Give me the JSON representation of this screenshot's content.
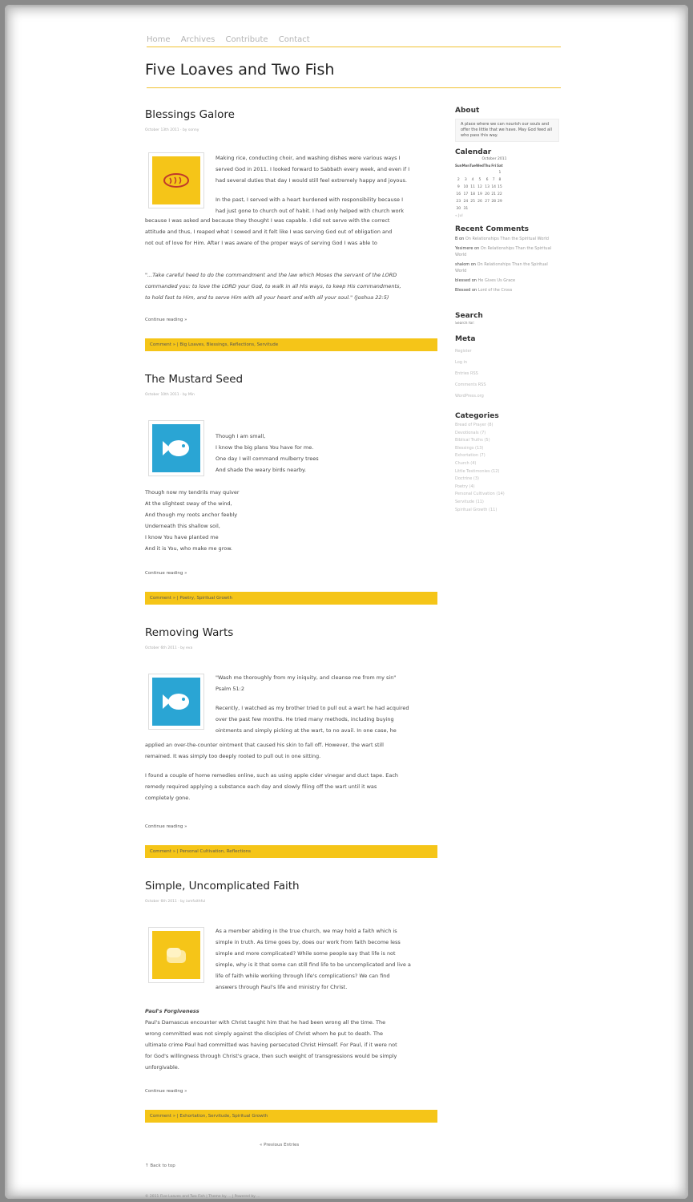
{
  "nav": [
    "Home",
    "Archives",
    "Contribute",
    "Contact"
  ],
  "site_title": "Five Loaves and Two Fish",
  "colors": {
    "accent": "#f5c518",
    "blue": "#2aa5d4"
  },
  "posts": [
    {
      "title": "Blessings Galore",
      "meta": "October 13th 2011 · by sonny",
      "thumb": {
        "color": "yellow",
        "icon": "bread-icon"
      },
      "wrap": [
        "Making rice, conducting choir, and washing dishes were various ways I",
        "served God in 2011. I looked forward to Sabbath every week, and even if I",
        "had several duties that day I would still feel extremely happy and joyous.",
        "",
        "In the past, I served with a heart burdened with responsibility because I",
        "had just gone to church out of habit. I had only helped with church work"
      ],
      "full": [
        "because I was asked and because they thought I was capable. I did not serve with the correct",
        "attitude and thus, I reaped what I sowed and it felt like I was serving God out of obligation and",
        "not out of love for Him.  After I was aware of the proper ways of serving God I was able to"
      ],
      "quote": [
        "\"...Take careful heed to do the commandment and the law which Moses the servant of the LORD",
        "commanded you: to love the LORD your God, to walk in all His ways, to keep His commandments,",
        "to hold fast to Him, and to serve Him with all your heart and with all your soul.\" (Joshua 22:5)"
      ],
      "continue": "Continue reading »",
      "footer": "Comment » | Big Loaves, Blessings, Reflections, Servitude"
    },
    {
      "title": "The Mustard Seed",
      "meta": "October 10th 2011 · by Min",
      "thumb": {
        "color": "blue",
        "icon": "fish-icon"
      },
      "wrap": [
        "Though I am small,",
        "I know the big plans You have for me.",
        "One day I will command mulberry trees",
        "And shade the weary birds nearby."
      ],
      "full": [
        "Though now my tendrils may quiver",
        "At the slightest sway of the wind,",
        "And though my roots anchor feebly",
        "Underneath this shallow soil,",
        "I know You have planted me",
        "And it is You, who make me grow."
      ],
      "continue": "Continue reading »",
      "footer": "Comment » | Poetry, Spiritual Growth"
    },
    {
      "title": "Removing Warts",
      "meta": "October 6th 2011 · by eva",
      "thumb": {
        "color": "blue",
        "icon": "fish-icon"
      },
      "wrap": [
        "\"Wash me thoroughly from my iniquity, and cleanse me from my sin\"",
        "Psalm 51:2",
        "",
        "Recently, I watched as my brother tried to pull out a wart he had acquired",
        "over the past few months. He tried many methods, including buying",
        "ointments and simply picking at the wart, to no avail. In one case, he"
      ],
      "full": [
        "applied an over-the-counter ointment that caused his skin to fall off. However, the wart still",
        "remained. It was simply too deeply rooted to pull out in one sitting.",
        "",
        "I found a couple of home remedies online, such as using apple cider vinegar and duct tape. Each",
        "remedy required applying a substance each day and slowly filing off the wart until it was",
        "completely gone."
      ],
      "continue": "Continue reading »",
      "footer": "Comment » | Personal Cultivation, Reflections"
    },
    {
      "title": "Simple, Uncomplicated Faith",
      "meta": "October 6th 2011 · by iamfaithful",
      "thumb": {
        "color": "yellow",
        "icon": "bread-loaf-icon"
      },
      "wrap": [
        "As a member abiding in the true church, we may hold a faith which is",
        "simple in truth. As time goes by, does our work from faith become less",
        "simple and more complicated? While some people say that life is not",
        "simple, why is it that some can still find life to be uncomplicated and live a",
        "life of faith while working through life's complications? We can find",
        "answers through Paul's life and ministry for Christ."
      ],
      "subhead": "Paul's Forgiveness",
      "full": [
        "Paul's Damascus encounter with Christ taught him that he had been wrong all the time. The",
        "wrong committed was not simply against the disciples of Christ whom he put to death. The",
        "ultimate crime Paul had committed was having persecuted Christ Himself. For Paul, if it were not",
        "for God's willingness through Christ's grace, then such weight of transgressions would be simply",
        "unforgivable."
      ],
      "continue": "Continue reading »",
      "footer": "Comment » | Exhortation, Servitude, Spiritual Growth"
    }
  ],
  "sidebar": {
    "about_title": "About",
    "about_text": "A place where we can nourish our souls and offer the little that we have. May God feed all who pass this way.",
    "calendar_title": "Calendar",
    "calendar_month": "October 2011",
    "calendar_days": [
      "Sun",
      "Mon",
      "Tue",
      "Wed",
      "Thu",
      "Fri",
      "Sat"
    ],
    "calendar_weeks": [
      [
        "",
        "",
        "",
        "",
        "",
        "",
        "1"
      ],
      [
        "2",
        "3",
        "4",
        "5",
        "6",
        "7",
        "8"
      ],
      [
        "9",
        "10",
        "11",
        "12",
        "13",
        "14",
        "15"
      ],
      [
        "16",
        "17",
        "18",
        "19",
        "20",
        "21",
        "22"
      ],
      [
        "23",
        "24",
        "25",
        "26",
        "27",
        "28",
        "29"
      ],
      [
        "30",
        "31",
        "",
        "",
        "",
        "",
        ""
      ]
    ],
    "calendar_prev": "« Jul",
    "recent_title": "Recent Comments",
    "recent_comments": [
      {
        "author": "B on",
        "post": "On Relationships Than the Spiritual World"
      },
      {
        "author": "Yesimere on",
        "post": "On Relationships Than the Spiritual World"
      },
      {
        "author": "shalom on",
        "post": "On Relationships Than the Spiritual World"
      },
      {
        "author": "blessed on",
        "post": "He Gives Us Grace"
      },
      {
        "author": "Blessed on",
        "post": "Lord of the Cross"
      }
    ],
    "search_title": "Search",
    "search_placeholder": "Search for:",
    "meta_title": "Meta",
    "meta_links": [
      "Register",
      "Log in",
      "Entries RSS",
      "Comments RSS",
      "WordPress.org"
    ],
    "categories_title": "Categories",
    "categories": [
      "Bread of Prayer (8)",
      "Devotionals (7)",
      "Biblical Truths (5)",
      "Blessings (13)",
      "Exhortation (7)",
      "Church (4)",
      "Little Testimonies (12)",
      "Doctrine (3)",
      "Poetry (4)",
      "Personal Cultivation (14)",
      "Servitude (11)",
      "Spiritual Growth (11)"
    ]
  },
  "pagination": "« Previous Entries",
  "back_to_top": "↑ Back to top",
  "copyright": "© 2011 Five Loaves and Two Fish | Theme by ... | Powered by ..."
}
